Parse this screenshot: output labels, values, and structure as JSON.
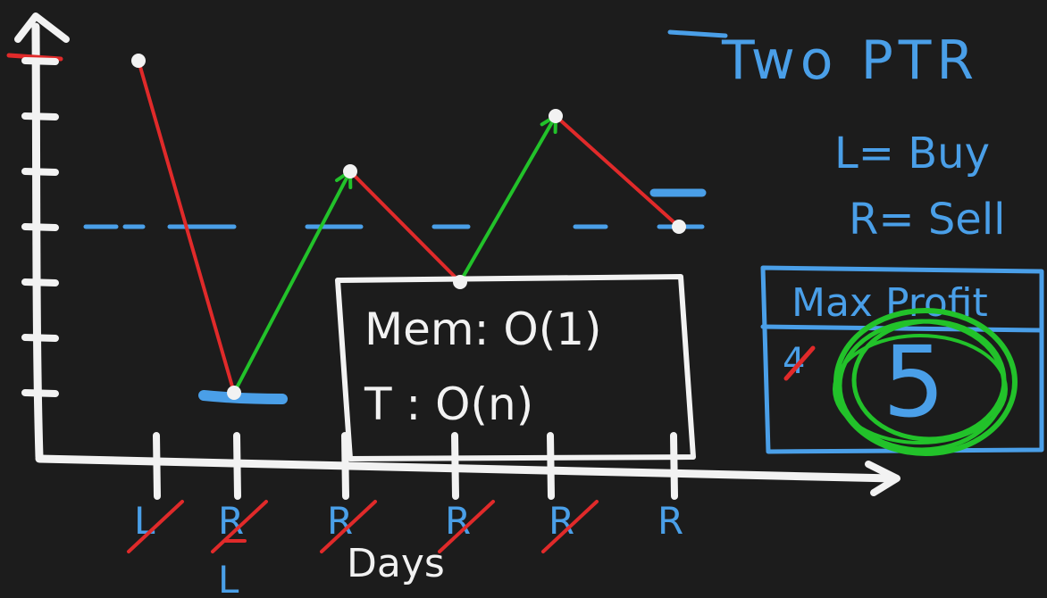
{
  "title": "Two PTR",
  "legend": {
    "left": "L= Buy",
    "right": "R= Sell"
  },
  "complexity": {
    "memory": "Mem: O(1)",
    "time": "T : O(n)"
  },
  "max_profit": {
    "label": "Max Profit",
    "previous": "4",
    "current": "5"
  },
  "axis": {
    "xlabel": "Days"
  },
  "day_labels": [
    {
      "label": "L",
      "crossed": true
    },
    {
      "label": "R",
      "crossed": true,
      "below": "L"
    },
    {
      "label": "R",
      "crossed": true
    },
    {
      "label": "R",
      "crossed": true
    },
    {
      "label": "R",
      "crossed": true
    },
    {
      "label": "R",
      "crossed": false
    }
  ],
  "colors": {
    "background": "#1c1c1c",
    "chalk": "#f2f2f2",
    "blue": "#4a9fe8",
    "red": "#e02a2a",
    "green": "#22c22a"
  },
  "chart_data": {
    "type": "line",
    "x": [
      1,
      2,
      3,
      4,
      5,
      6
    ],
    "values": [
      7,
      1,
      5,
      3,
      6,
      4
    ],
    "ylim": [
      0,
      7
    ],
    "segments": [
      {
        "from": 1,
        "to": 2,
        "color": "red"
      },
      {
        "from": 2,
        "to": 3,
        "color": "green"
      },
      {
        "from": 3,
        "to": 4,
        "color": "red"
      },
      {
        "from": 4,
        "to": 5,
        "color": "green"
      },
      {
        "from": 5,
        "to": 6,
        "color": "red"
      }
    ],
    "reference_level": 4
  }
}
